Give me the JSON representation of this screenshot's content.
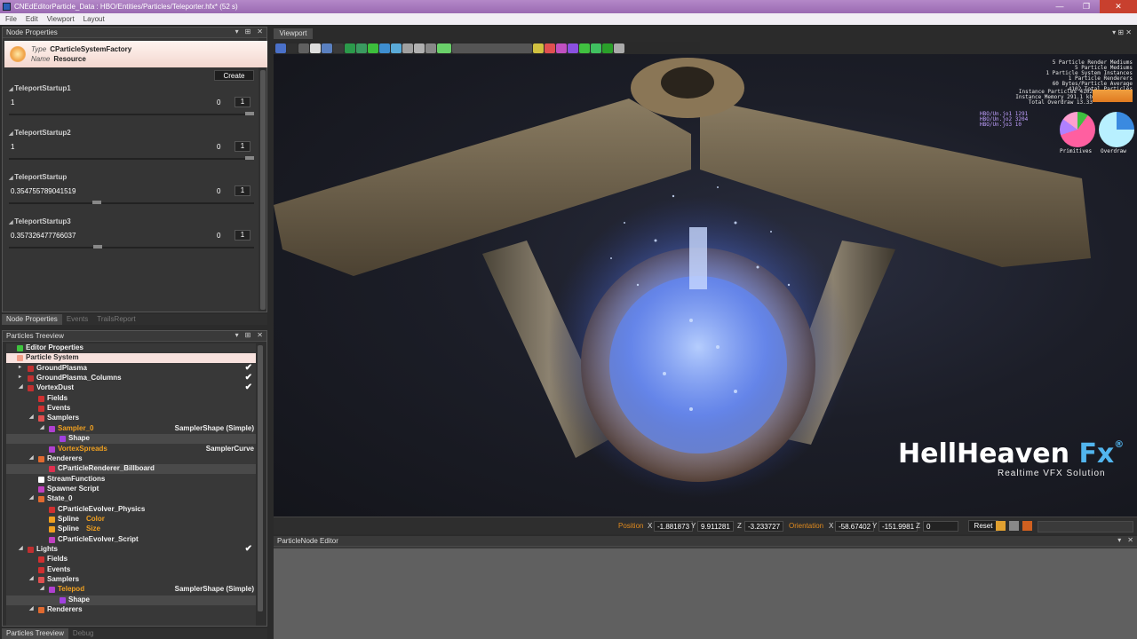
{
  "window": {
    "title": "CNEdEditorParticle_Data : HBO/Entities/Particles/Teleporter.hfx* (52 s)",
    "min": "—",
    "max": "❐",
    "close": "✕"
  },
  "menu": [
    "File",
    "Edit",
    "Viewport",
    "Layout"
  ],
  "node_properties": {
    "title": "Node Properties",
    "type_label": "Type",
    "type_value": "CParticleSystemFactory",
    "name_label": "Name",
    "name_value": "Resource",
    "create_label": "Create",
    "props": [
      {
        "name": "TeleportStartup1",
        "value": "1",
        "min": "0",
        "max": "1",
        "fraction": 1.0
      },
      {
        "name": "TeleportStartup2",
        "value": "1",
        "min": "0",
        "max": "1",
        "fraction": 1.0
      },
      {
        "name": "TeleportStartup",
        "value": "0.354755789041519",
        "min": "0",
        "max": "1",
        "fraction": 0.355
      },
      {
        "name": "TeleportStartup3",
        "value": "0.357326477766037",
        "min": "0",
        "max": "1",
        "fraction": 0.357
      }
    ],
    "tabs": [
      "Node Properties",
      "Events",
      "TrailsReport"
    ]
  },
  "treeview": {
    "title": "Particles Treeview",
    "rows": [
      {
        "label": "Editor Properties",
        "depth": 0,
        "icon": "#3ec43e",
        "tog": ""
      },
      {
        "label": "Particle System",
        "depth": 0,
        "icon": "#f3a08a",
        "tog": "",
        "sel": true
      },
      {
        "label": "GroundPlasma",
        "depth": 1,
        "icon": "#c03030",
        "tog": "▸",
        "chk": "✔"
      },
      {
        "label": "GroundPlasma_Columns",
        "depth": 1,
        "icon": "#c03030",
        "tog": "▸",
        "chk": "✔"
      },
      {
        "label": "VortexDust",
        "depth": 1,
        "icon": "#c03030",
        "tog": "◢",
        "chk": "✔"
      },
      {
        "label": "Fields",
        "depth": 2,
        "icon": "#d03030",
        "tog": ""
      },
      {
        "label": "Events",
        "depth": 2,
        "icon": "#d03030",
        "tog": ""
      },
      {
        "label": "Samplers",
        "depth": 2,
        "icon": "#e05050",
        "tog": "◢"
      },
      {
        "label": "Sampler_0",
        "depth": 3,
        "icon": "#b040d0",
        "tog": "◢",
        "orange": true,
        "desc": "SamplerShape (Simple)"
      },
      {
        "label": "Shape",
        "depth": 4,
        "icon": "#a040e0",
        "tog": "",
        "sub": true
      },
      {
        "label": "VortexSpreads",
        "depth": 3,
        "icon": "#b040d0",
        "tog": "",
        "orange": true,
        "desc": "SamplerCurve"
      },
      {
        "label": "Renderers",
        "depth": 2,
        "icon": "#e06a30",
        "tog": "◢"
      },
      {
        "label": "CParticleRenderer_Billboard",
        "depth": 3,
        "icon": "#e03050",
        "tog": "",
        "sub": true
      },
      {
        "label": "StreamFunctions",
        "depth": 2,
        "icon": "#ffffff",
        "tog": ""
      },
      {
        "label": "Spawner Script",
        "depth": 2,
        "icon": "#c040c0",
        "tog": ""
      },
      {
        "label": "State_0",
        "depth": 2,
        "icon": "#e06a30",
        "tog": "◢"
      },
      {
        "label": "CParticleEvolver_Physics",
        "depth": 3,
        "icon": "#d03030",
        "tog": ""
      },
      {
        "label": "Spline",
        "depth": 3,
        "icon": "#f0a020",
        "tog": "",
        "desc2": "Color"
      },
      {
        "label": "Spline",
        "depth": 3,
        "icon": "#f0a020",
        "tog": "",
        "desc2": "Size"
      },
      {
        "label": "CParticleEvolver_Script",
        "depth": 3,
        "icon": "#c040c0",
        "tog": ""
      },
      {
        "label": "Lights",
        "depth": 1,
        "icon": "#c03030",
        "tog": "◢",
        "chk": "✔"
      },
      {
        "label": "Fields",
        "depth": 2,
        "icon": "#d03030",
        "tog": ""
      },
      {
        "label": "Events",
        "depth": 2,
        "icon": "#d03030",
        "tog": ""
      },
      {
        "label": "Samplers",
        "depth": 2,
        "icon": "#e05050",
        "tog": "◢"
      },
      {
        "label": "Telepod",
        "depth": 3,
        "icon": "#b040d0",
        "tog": "◢",
        "orange": true,
        "desc": "SamplerShape (Simple)"
      },
      {
        "label": "Shape",
        "depth": 4,
        "icon": "#a040e0",
        "tog": "",
        "sub": true
      },
      {
        "label": "Renderers",
        "depth": 2,
        "icon": "#e06a30",
        "tog": "◢"
      }
    ],
    "tabs": [
      "Particles Treeview",
      "Debug"
    ]
  },
  "viewport": {
    "tab": "Viewport",
    "stats_top": [
      "5 Particle Render Mediums",
      "5 Particle Mediums",
      "1 Particle System Instances",
      "1 Particle Renderers",
      "60 Bytes/Particle Average",
      "4102 Total Particles"
    ],
    "stats_mid": [
      "Instance Particles  4102",
      "Instance Memory  291.1 kb",
      "Total Overdraw    13.33"
    ],
    "stats_low": [
      "HBO/Un.jo1  1291",
      "HBO/Un.jo2  3204",
      "HBO/Un.jo3    10"
    ],
    "pie1_label": "Primitives",
    "pie2_label": "Overdraw",
    "brand": "HellHeaven",
    "brand_fx": "Fx",
    "brand_reg": "®",
    "tagline": "Realtime VFX Solution"
  },
  "statusbar": {
    "position_label": "Position",
    "pos_x": "-1.881873",
    "pos_y": "9.911281",
    "pos_z": "-3.233727",
    "orientation_label": "Orientation",
    "or_x": "-58.67402",
    "or_y": "-151.9981",
    "or_z": "0",
    "x": "X",
    "y": "Y",
    "z": "Z",
    "reset": "Reset"
  },
  "editor": {
    "title": "ParticleNode Editor"
  },
  "colors": {
    "accent": "#e08a1e",
    "selected_row": "#f8e2de",
    "brand_blue": "#52b5ee"
  }
}
